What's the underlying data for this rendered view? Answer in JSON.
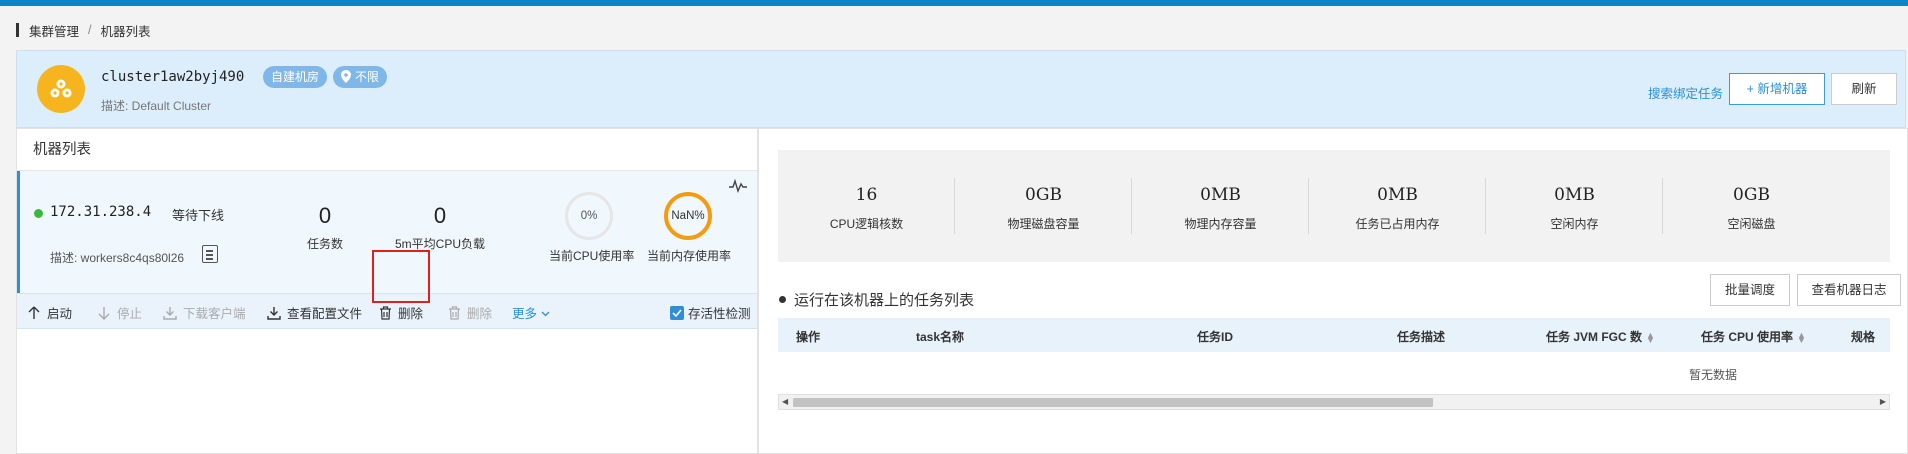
{
  "breadcrumb": {
    "parent": "集群管理",
    "sep": "/",
    "current": "机器列表"
  },
  "cluster": {
    "name": "cluster1aw2byj490",
    "tag_room": "自建机房",
    "tag_region": "不限",
    "desc": "描述: Default Cluster"
  },
  "header_actions": {
    "search_bound_tasks": "搜索绑定任务",
    "add_machine": "+ 新增机器",
    "refresh": "刷新"
  },
  "left": {
    "title": "机器列表",
    "machine": {
      "ip": "172.31.238.4",
      "state": "等待下线",
      "status_color": "#3cb93c",
      "desc": "描述: workers8c4qs80l26",
      "stats": [
        {
          "value": "0",
          "label": "任务数"
        },
        {
          "value": "0",
          "label": "5m平均CPU负载"
        }
      ],
      "cpu_gauge": {
        "value": "0%",
        "label": "当前CPU使用率"
      },
      "mem_gauge": {
        "value": "NaN%",
        "label": "当前内存使用率"
      }
    },
    "toolbar": {
      "start": "启动",
      "stop": "停止",
      "download_client": "下载客户端",
      "view_config": "查看配置文件",
      "delete": "删除",
      "delete_disabled": "删除",
      "more": "更多",
      "liveness": "存活性检测"
    }
  },
  "right": {
    "summary": [
      {
        "value": "16",
        "label": "CPU逻辑核数"
      },
      {
        "value": "0GB",
        "label": "物理磁盘容量"
      },
      {
        "value": "0MB",
        "label": "物理内存容量"
      },
      {
        "value": "0MB",
        "label": "任务已占用内存"
      },
      {
        "value": "0MB",
        "label": "空闲内存"
      },
      {
        "value": "0GB",
        "label": "空闲磁盘"
      }
    ],
    "tasks_title": "运行在该机器上的任务列表",
    "batch_schedule": "批量调度",
    "view_log": "查看机器日志",
    "columns": [
      "操作",
      "task名称",
      "任务ID",
      "任务描述",
      "任务 JVM FGC 数",
      "任务 CPU 使用率",
      "规格"
    ],
    "empty": "暂无数据"
  },
  "colors": {
    "accent": "#2c8fd8",
    "topbar": "#0a85c8",
    "logo": "#f6b51f",
    "mem_ring": "#f39c12",
    "highlight": "#e02020"
  }
}
